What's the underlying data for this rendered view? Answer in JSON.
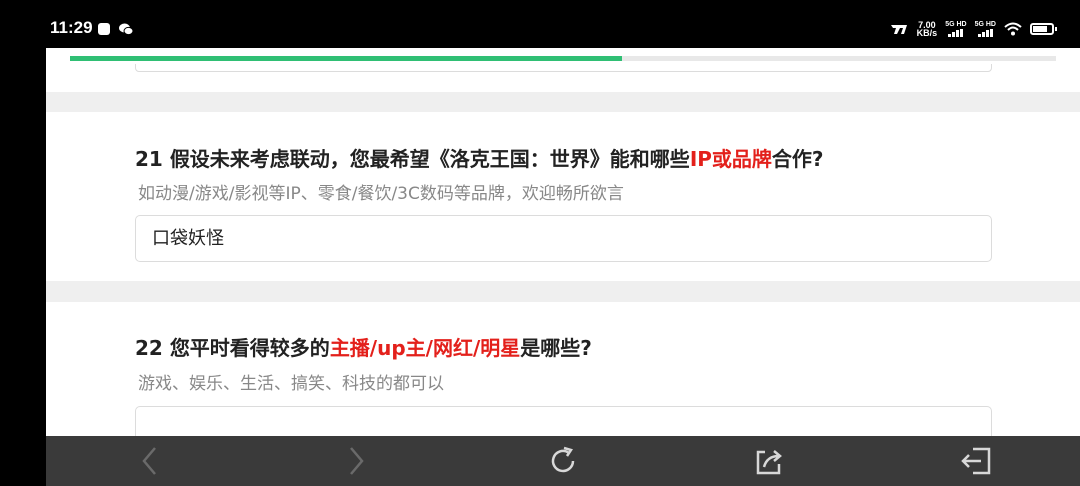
{
  "status_bar": {
    "time": "11:29",
    "speed_value": "7.00",
    "speed_unit": "KB/s",
    "sim1_label": "5G HD",
    "sim2_label": "5G HD",
    "icons": [
      "notification-square-icon",
      "wechat-icon",
      "nfc-icon",
      "signal-icon",
      "wifi-icon",
      "battery-icon"
    ]
  },
  "progress": {
    "fraction": 0.56,
    "color": "#2fbf74"
  },
  "questions": [
    {
      "number": "21",
      "title_before": "假设未来考虑联动，您最希望《洛克王国：世界》能和哪些",
      "title_highlight": "IP或品牌",
      "title_after": "合作?",
      "description": "如动漫/游戏/影视等IP、零食/餐饮/3C数码等品牌，欢迎畅所欲言",
      "answer": "口袋妖怪"
    },
    {
      "number": "22",
      "title_before": "您平时看得较多的",
      "title_highlight": "主播/up主/网红/明星",
      "title_after": "是哪些?",
      "description": "游戏、娱乐、生活、搞笑、科技的都可以",
      "answer": ""
    }
  ],
  "colors": {
    "highlight": "#e3201b",
    "page_bg": "#efefef",
    "toolbar_bg": "#3a3a3a"
  },
  "toolbar": {
    "buttons": [
      "back-arrow-icon",
      "forward-arrow-icon",
      "refresh-icon",
      "share-icon",
      "exit-icon"
    ]
  }
}
